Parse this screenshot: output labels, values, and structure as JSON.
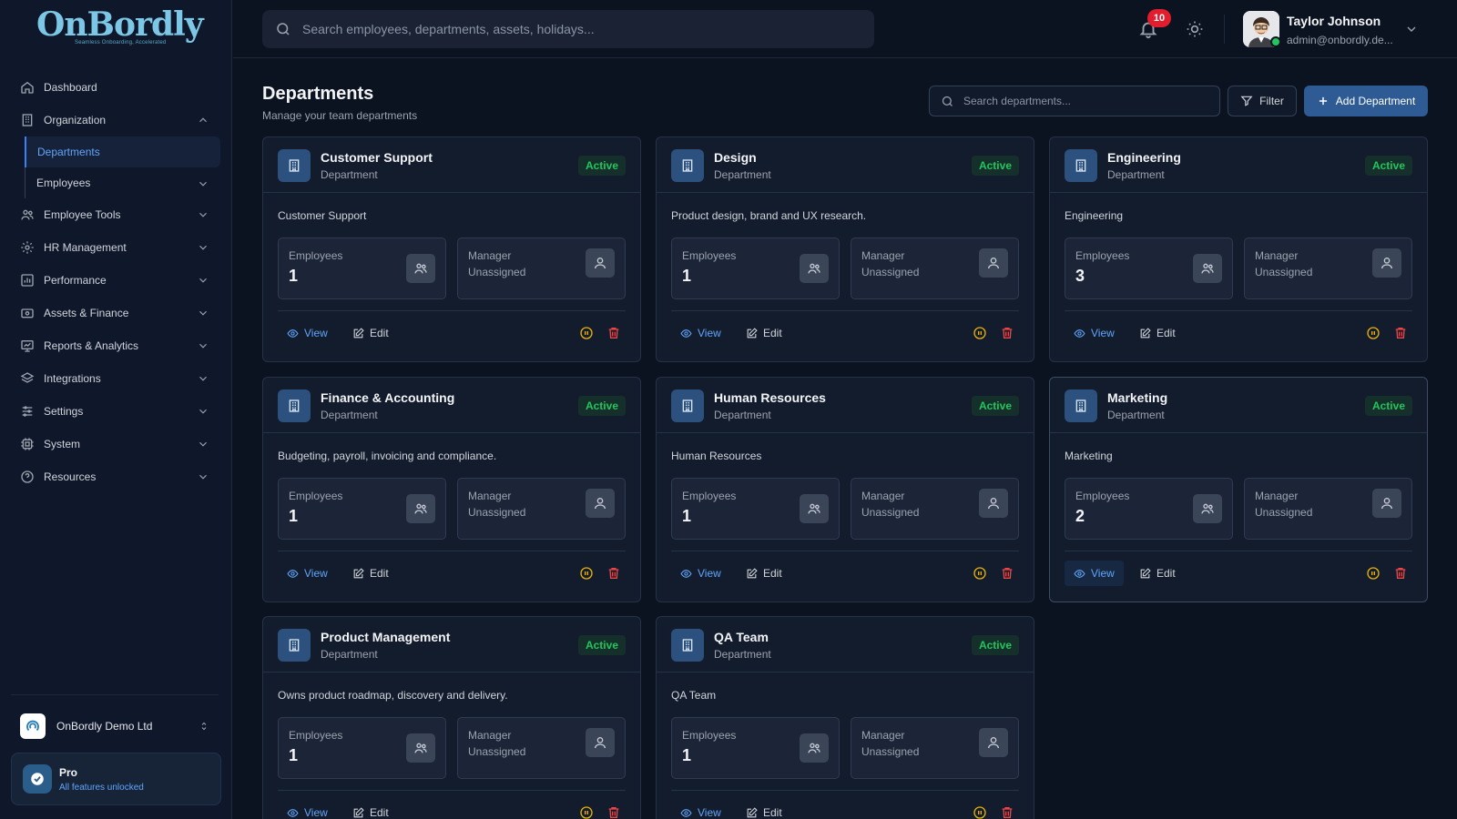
{
  "brand": {
    "logo_text": "OnBordly",
    "tagline": "Seamless Onboarding, Accelerated"
  },
  "sidebar": {
    "items": [
      {
        "label": "Dashboard",
        "icon": "home-icon"
      },
      {
        "label": "Organization",
        "icon": "building-icon",
        "expanded": true
      },
      {
        "label": "Employee Tools",
        "icon": "users-icon"
      },
      {
        "label": "HR Management",
        "icon": "people-gear-icon"
      },
      {
        "label": "Performance",
        "icon": "chart-icon"
      },
      {
        "label": "Assets & Finance",
        "icon": "wallet-icon"
      },
      {
        "label": "Reports & Analytics",
        "icon": "report-icon"
      },
      {
        "label": "Integrations",
        "icon": "layers-icon"
      },
      {
        "label": "Settings",
        "icon": "sliders-icon"
      },
      {
        "label": "System",
        "icon": "cpu-icon"
      },
      {
        "label": "Resources",
        "icon": "help-icon"
      }
    ],
    "sub_items": [
      {
        "label": "Departments",
        "active": true
      },
      {
        "label": "Employees",
        "active": false
      }
    ],
    "org_name": "OnBordly Demo Ltd",
    "plan": {
      "title": "Pro",
      "subtitle": "All features unlocked"
    }
  },
  "topbar": {
    "search_placeholder": "Search employees, departments, assets, holidays...",
    "notifications_count": "10",
    "user": {
      "name": "Taylor Johnson",
      "email": "admin@onbordly.de..."
    }
  },
  "page": {
    "title": "Departments",
    "subtitle": "Manage your team departments",
    "search_placeholder": "Search departments...",
    "filter_label": "Filter",
    "add_label": "Add Department"
  },
  "labels": {
    "type": "Department",
    "status": "Active",
    "employees": "Employees",
    "manager": "Manager",
    "unassigned": "Unassigned",
    "view": "View",
    "edit": "Edit"
  },
  "colors": {
    "accent": "#2e5b94",
    "active": "#22c55e",
    "pause": "#eab308",
    "delete": "#ef4444"
  },
  "departments": [
    {
      "name": "Customer Support",
      "description": "Customer Support",
      "employees": "1"
    },
    {
      "name": "Design",
      "description": "Product design, brand and UX research.",
      "employees": "1"
    },
    {
      "name": "Engineering",
      "description": "Engineering",
      "employees": "3"
    },
    {
      "name": "Finance & Accounting",
      "description": "Budgeting, payroll, invoicing and compliance.",
      "employees": "1"
    },
    {
      "name": "Human Resources",
      "description": "Human Resources",
      "employees": "1"
    },
    {
      "name": "Marketing",
      "description": "Marketing",
      "employees": "2"
    },
    {
      "name": "Product Management",
      "description": "Owns product roadmap, discovery and delivery.",
      "employees": "1"
    },
    {
      "name": "QA Team",
      "description": "QA Team",
      "employees": "1"
    }
  ]
}
